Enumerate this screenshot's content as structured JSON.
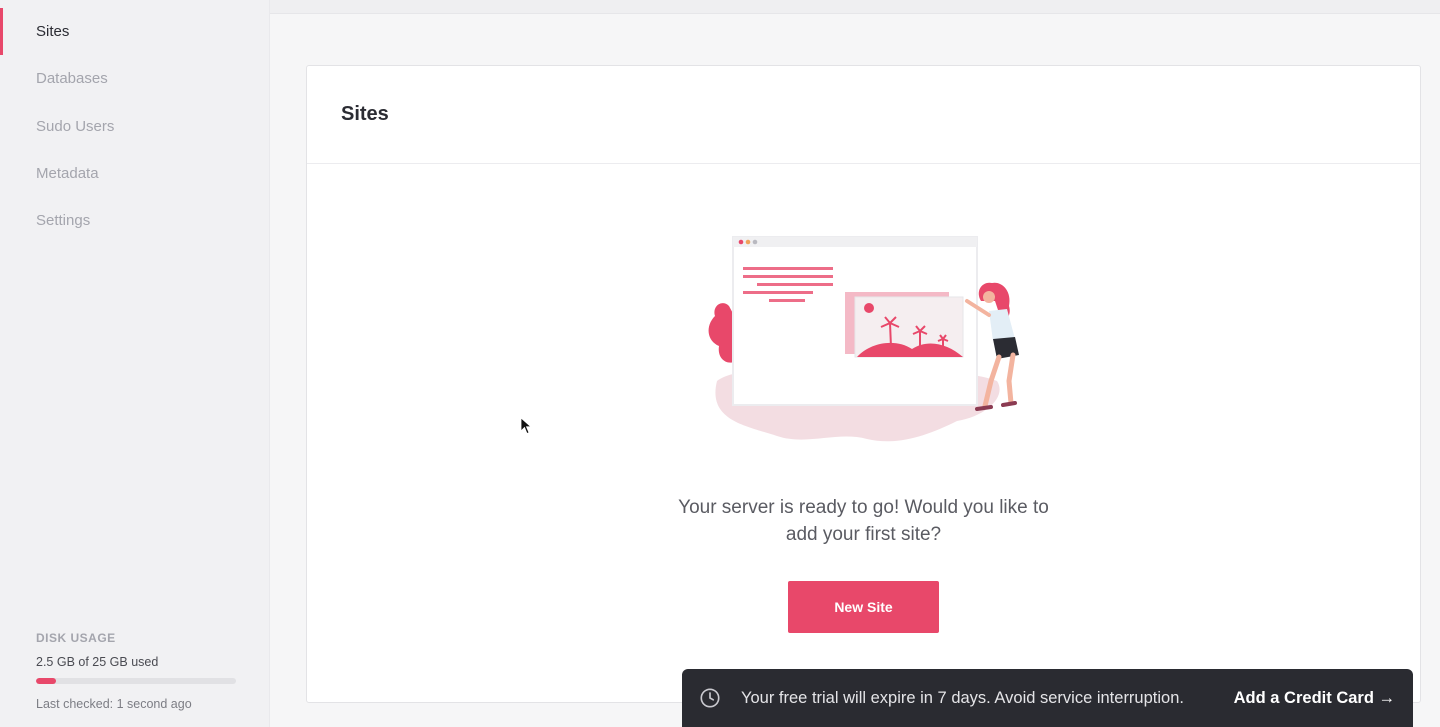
{
  "sidebar": {
    "items": [
      {
        "label": "Sites",
        "active": true
      },
      {
        "label": "Databases"
      },
      {
        "label": "Sudo Users"
      },
      {
        "label": "Metadata"
      },
      {
        "label": "Settings"
      }
    ],
    "disk": {
      "title": "DISK USAGE",
      "used_text": "2.5 GB of 25 GB used",
      "used_fraction": 0.1,
      "last_checked": "Last checked: 1 second ago"
    }
  },
  "card": {
    "title": "Sites",
    "empty_line1": "Your server is ready to go! Would you like to",
    "empty_line2": "add your first site?",
    "button_label": "New Site"
  },
  "toast": {
    "icon": "clock-icon",
    "message": "Your free trial will expire in 7 days. Avoid service interruption.",
    "link_label": "Add a Credit Card →"
  },
  "colors": {
    "accent": "#e8486a",
    "toast_bg": "#2a2b31"
  }
}
